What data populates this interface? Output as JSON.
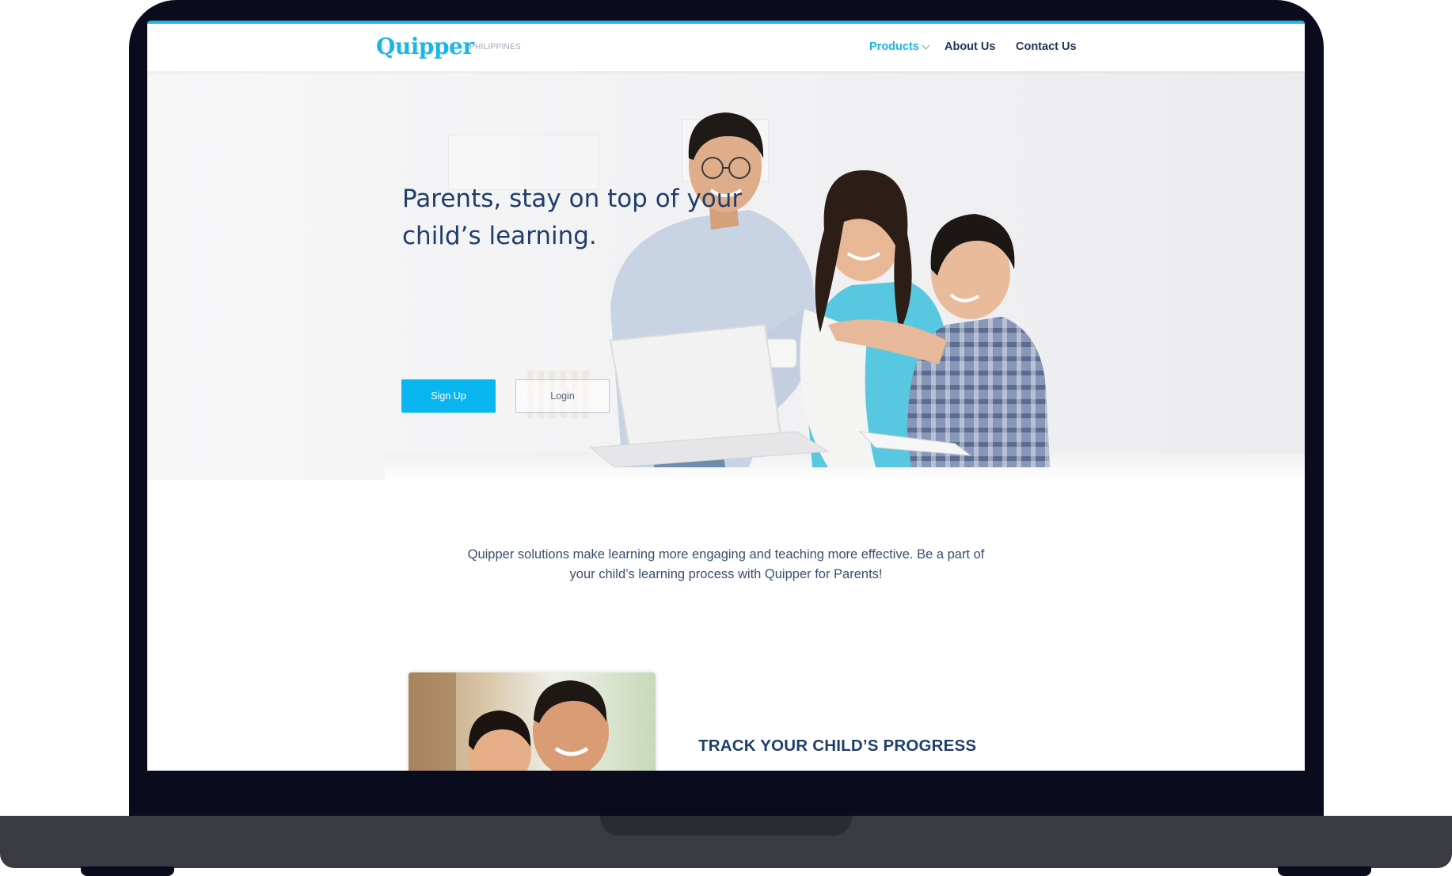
{
  "header": {
    "logo": "Quipper",
    "logo_sub": "PHILIPPINES",
    "nav": {
      "products": "Products",
      "about": "About Us",
      "contact": "Contact Us"
    }
  },
  "hero": {
    "title": "Parents, stay on top of your child’s learning.",
    "signup_label": "Sign Up",
    "login_label": "Login"
  },
  "intro": {
    "text": "Quipper solutions make learning more engaging and teaching more effective. Be a part of your child’s learning process with Quipper for Parents!"
  },
  "feature": {
    "title": "TRACK YOUR CHILD’S PROGRESS"
  },
  "colors": {
    "accent": "#1ab6e6",
    "navy": "#1f3f6a",
    "frame": "#0b0b1e",
    "base": "#3a3a43"
  },
  "icons": {
    "products_dropdown": "chevron-down-icon"
  }
}
